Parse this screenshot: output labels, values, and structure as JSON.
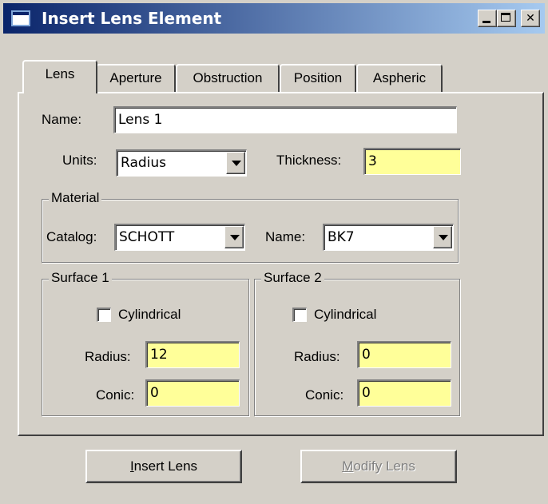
{
  "window": {
    "title": "Insert Lens Element",
    "controls": {
      "minimize": "_",
      "maximize": "□",
      "close": "✕"
    }
  },
  "tabs": [
    {
      "label": "Lens",
      "active": true
    },
    {
      "label": "Aperture",
      "active": false
    },
    {
      "label": "Obstruction",
      "active": false
    },
    {
      "label": "Position",
      "active": false
    },
    {
      "label": "Aspheric",
      "active": false
    }
  ],
  "lens": {
    "name_label": "Name:",
    "name_value": "Lens 1",
    "units_label": "Units:",
    "units_value": "Radius",
    "thickness_label": "Thickness:",
    "thickness_value": "3"
  },
  "material": {
    "title": "Material",
    "catalog_label": "Catalog:",
    "catalog_value": "SCHOTT",
    "name_label": "Name:",
    "name_value": "BK7"
  },
  "surface1": {
    "title": "Surface 1",
    "cylindrical_label": "Cylindrical",
    "cylindrical_checked": false,
    "radius_label": "Radius:",
    "radius_value": "12",
    "conic_label": "Conic:",
    "conic_value": "0"
  },
  "surface2": {
    "title": "Surface 2",
    "cylindrical_label": "Cylindrical",
    "cylindrical_checked": false,
    "radius_label": "Radius:",
    "radius_value": "0",
    "conic_label": "Conic:",
    "conic_value": "0"
  },
  "buttons": {
    "insert_mnemonic": "I",
    "insert_rest": "nsert Lens",
    "modify_mnemonic": "M",
    "modify_rest": "odify Lens",
    "modify_enabled": false
  },
  "colors": {
    "face": "#d4d0c8",
    "title_start": "#0a246a",
    "title_end": "#a6caf0",
    "numeric_field": "#ffff99"
  }
}
